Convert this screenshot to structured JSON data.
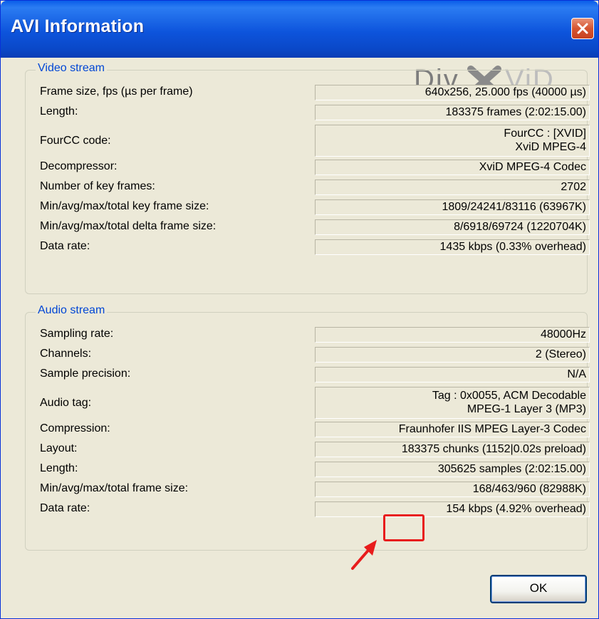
{
  "window": {
    "title": "AVI Information",
    "logo_text": "DivX ViD"
  },
  "video": {
    "title": "Video stream",
    "rows": [
      {
        "label": "Frame size, fps (µs per frame)",
        "value": "640x256, 25.000 fps (40000 µs)"
      },
      {
        "label": "Length:",
        "value": "183375 frames (2:02:15.00)"
      },
      {
        "label": "FourCC code:",
        "value": "FourCC : [XVID]",
        "value2": "XviD MPEG-4"
      },
      {
        "label": "Decompressor:",
        "value": "XviD MPEG-4 Codec"
      },
      {
        "label": "Number of key frames:",
        "value": "2702"
      },
      {
        "label": "Min/avg/max/total key frame size:",
        "value": "1809/24241/83116 (63967K)"
      },
      {
        "label": "Min/avg/max/total delta frame size:",
        "value": "8/6918/69724 (1220704K)"
      },
      {
        "label": "Data rate:",
        "value": "1435 kbps (0.33% overhead)"
      }
    ]
  },
  "audio": {
    "title": "Audio stream",
    "rows": [
      {
        "label": "Sampling rate:",
        "value": "48000Hz"
      },
      {
        "label": "Channels:",
        "value": "2 (Stereo)"
      },
      {
        "label": "Sample precision:",
        "value": "N/A"
      },
      {
        "label": "Audio tag:",
        "value": "Tag : 0x0055, ACM Decodable",
        "value2": "MPEG-1 Layer 3 (MP3)"
      },
      {
        "label": "Compression:",
        "value": "Fraunhofer IIS MPEG Layer-3 Codec"
      },
      {
        "label": "Layout:",
        "value": "183375 chunks (1152|0.02s preload)"
      },
      {
        "label": "Length:",
        "value": "305625 samples (2:02:15.00)"
      },
      {
        "label": "Min/avg/max/total frame size:",
        "value": "168/463/960 (82988K)"
      },
      {
        "label": "Data rate:",
        "value": "154 kbps (4.92% overhead)"
      }
    ]
  },
  "buttons": {
    "ok": "OK"
  },
  "colors": {
    "titlebar": "#0a54dc",
    "group_title": "#0046d5",
    "highlight": "#e81c1c",
    "dialog_bg": "#ece9d8"
  }
}
